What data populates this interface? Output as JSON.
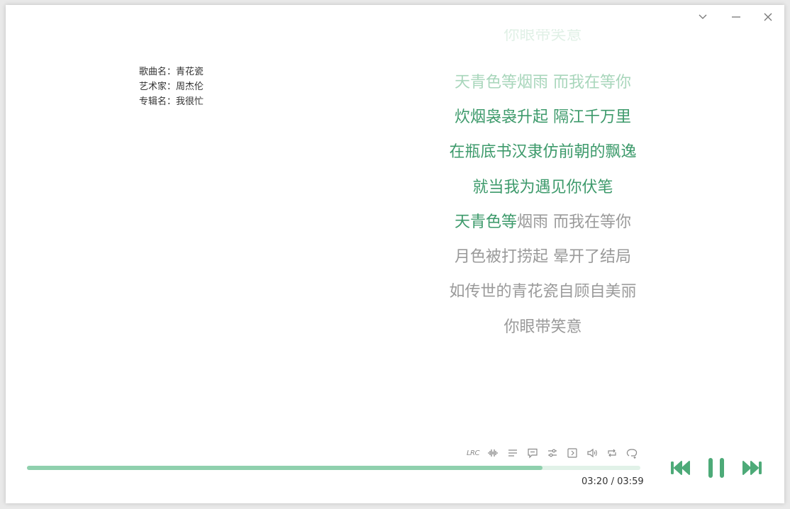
{
  "window": {
    "controls": [
      {
        "name": "minimize-to-tray-icon",
        "glyph": "⌄"
      },
      {
        "name": "minimize-icon",
        "glyph": "—"
      },
      {
        "name": "close-icon",
        "glyph": "✕"
      }
    ]
  },
  "song_info": {
    "title_label": "歌曲名：",
    "title": "青花瓷",
    "artist_label": "艺术家：",
    "artist": "周杰伦",
    "album_label": "专辑名：",
    "album": "我很忙"
  },
  "lyrics": {
    "lines": [
      {
        "text": "你眼带笑意",
        "state": "fade-top"
      },
      {
        "text": "天青色等烟雨 而我在等你",
        "state": "light-green"
      },
      {
        "text": "炊烟袅袅升起 隔江千万里",
        "state": "past"
      },
      {
        "text": "在瓶底书汉隶仿前朝的飘逸",
        "state": "past"
      },
      {
        "text": "就当我为遇见你伏笔",
        "state": "past"
      },
      {
        "text_sung": "天青色等",
        "text_rest": "烟雨 而我在等你",
        "state": "current"
      },
      {
        "text": "月色被打捞起 晕开了结局",
        "state": "future"
      },
      {
        "text": "如传世的青花瓷自顾自美丽",
        "state": "future"
      },
      {
        "text": "你眼带笑意",
        "state": "future"
      }
    ]
  },
  "toolbar": {
    "lrc_label": "LRC",
    "icons": [
      "waveform-icon",
      "playlist-icon",
      "comment-icon",
      "equalizer-icon",
      "expand-icon",
      "volume-icon",
      "repeat-icon",
      "loop-one-icon"
    ]
  },
  "player": {
    "progress_fraction": 0.84,
    "current_time": "03:20",
    "separator": "/",
    "total_time": "03:59"
  },
  "colors": {
    "accent": "#3d9a6b",
    "accent_light": "#8fd0ad",
    "icon_gray": "#8a8a8a"
  }
}
